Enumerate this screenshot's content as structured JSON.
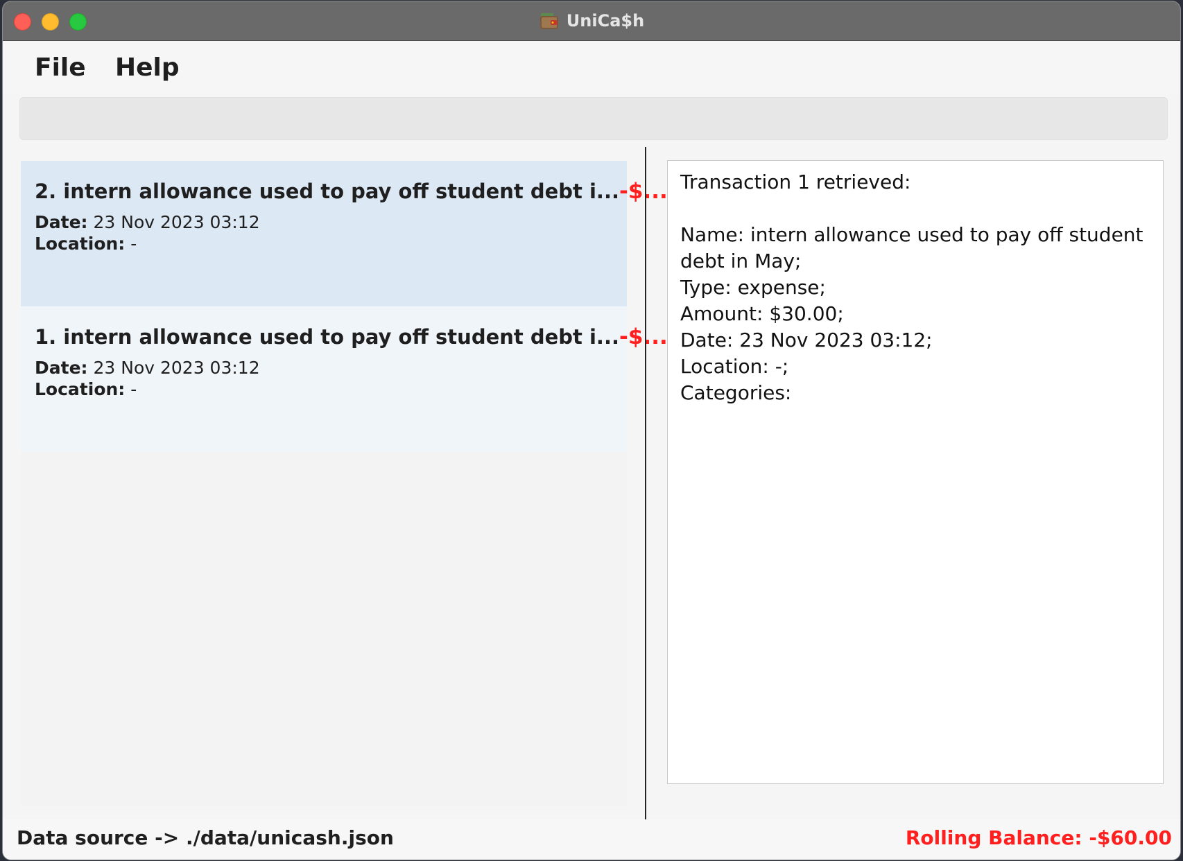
{
  "window": {
    "title": "UniCa$h",
    "icon": "wallet-icon"
  },
  "menu": {
    "file_label": "File",
    "help_label": "Help"
  },
  "command_box": {
    "value": ""
  },
  "transactions": [
    {
      "name": "2. intern allowance used to pay off student debt i...",
      "amount": "-$...",
      "date_label": "Date:",
      "date": "23 Nov 2023 03:12",
      "location_label": "Location:",
      "location": "-",
      "selected": true
    },
    {
      "name": "1. intern allowance used to pay off student debt i...",
      "amount": "-$...",
      "date_label": "Date:",
      "date": "23 Nov 2023 03:12",
      "location_label": "Location:",
      "location": "-",
      "selected": false
    }
  ],
  "result": {
    "lines": [
      "Transaction 1 retrieved:",
      "",
      "Name: intern allowance used to pay off student",
      "debt in May;",
      "Type: expense;",
      "Amount: $30.00;",
      "Date: 23 Nov 2023 03:12;",
      "Location: -;",
      "Categories:"
    ]
  },
  "status": {
    "data_source": "Data source -> ./data/unicash.json",
    "rolling_balance": "Rolling Balance: -$60.00"
  },
  "colors": {
    "expense": "#ff1f1f",
    "selected_card": "#dce9f5",
    "card": "#f0f5fa"
  }
}
